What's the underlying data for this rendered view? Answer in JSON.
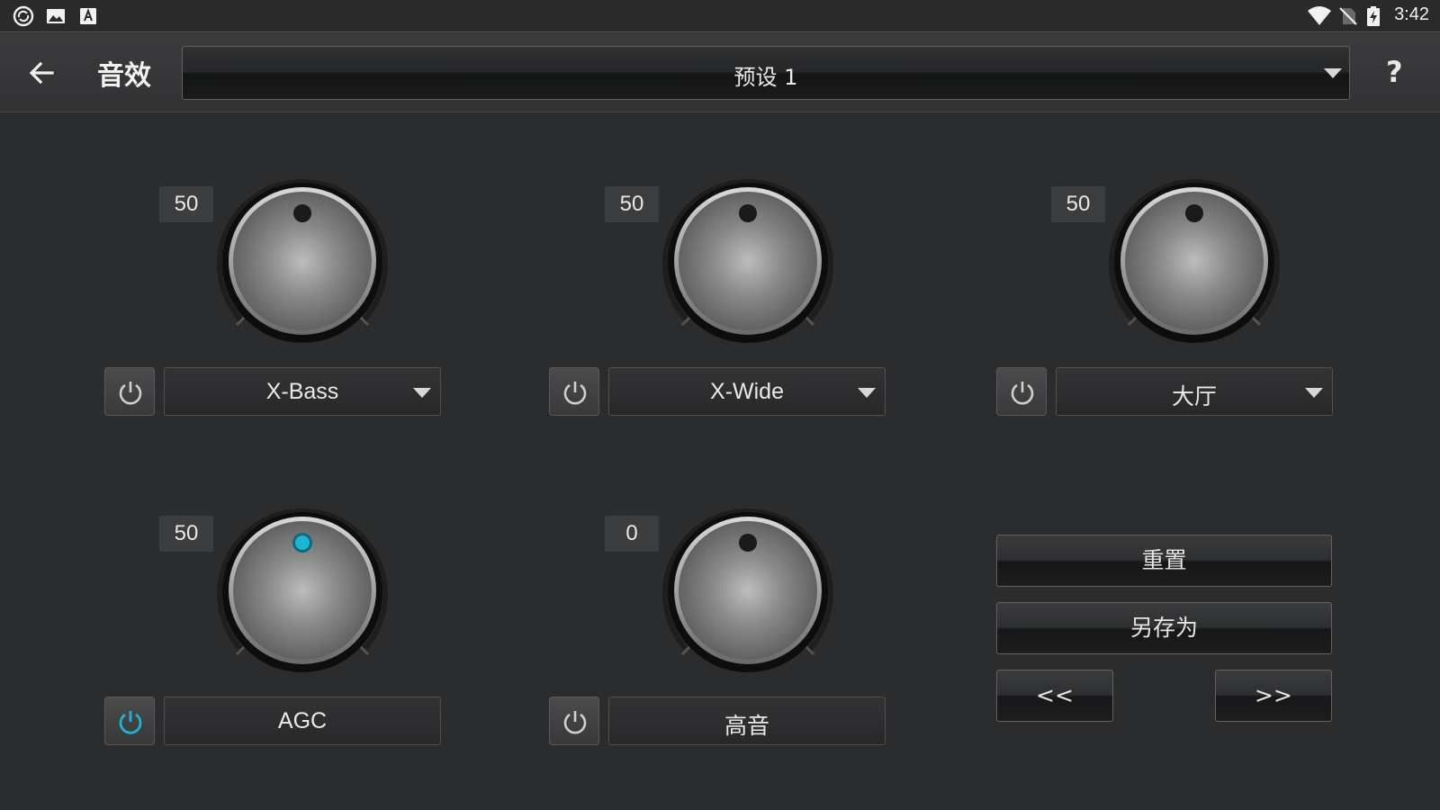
{
  "status_bar": {
    "left_icons": [
      "sync-app-icon",
      "gallery-icon",
      "keyboard-a-icon"
    ],
    "right_icons": [
      "wifi-icon",
      "no-sim-icon",
      "battery-charging-icon"
    ],
    "time": "3:42"
  },
  "app_bar": {
    "back_icon": "arrow-left-icon",
    "title": "音效",
    "preset_selected": "预设 1",
    "help_label": "?"
  },
  "knobs": [
    {
      "value": "50",
      "label": "X-Bass",
      "has_dropdown": true,
      "enabled": false,
      "level": 0.5
    },
    {
      "value": "50",
      "label": "X-Wide",
      "has_dropdown": true,
      "enabled": false,
      "level": 0.5
    },
    {
      "value": "50",
      "label": "大厅",
      "has_dropdown": true,
      "enabled": false,
      "level": 0.5
    },
    {
      "value": "50",
      "label": "AGC",
      "has_dropdown": false,
      "enabled": true,
      "level": 0.5
    },
    {
      "value": "0",
      "label": "高音",
      "has_dropdown": false,
      "enabled": false,
      "level": 0.5
    }
  ],
  "actions": {
    "reset": "重置",
    "save_as": "另存为",
    "prev": "<<",
    "next": ">>"
  },
  "colors": {
    "accent": "#1fb5d0",
    "background": "#2b2c2e"
  }
}
